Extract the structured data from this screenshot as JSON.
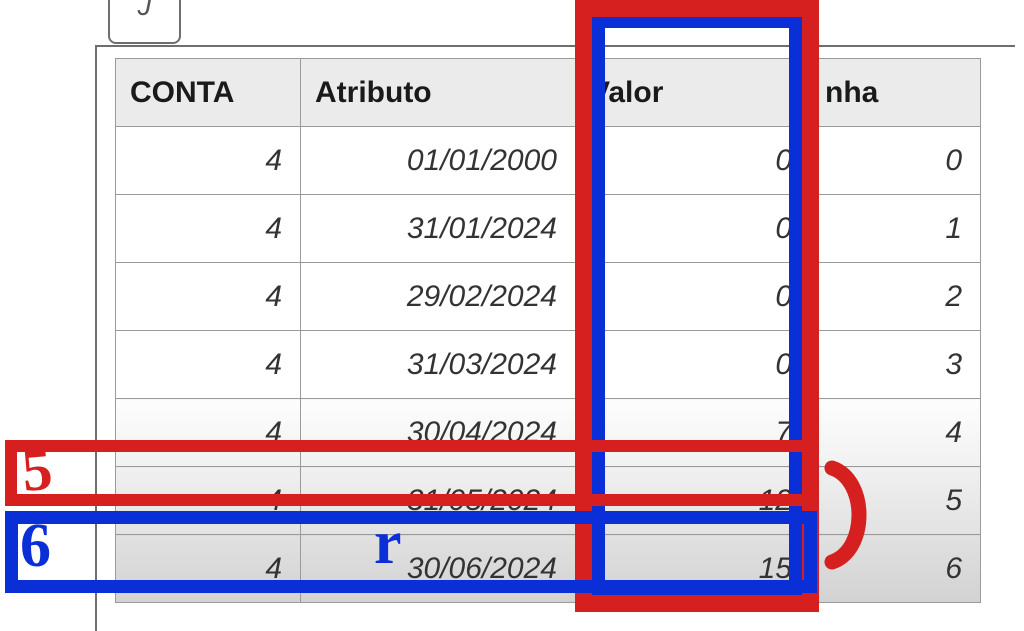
{
  "tab_stub": "J",
  "headers": {
    "conta": "CONTA",
    "atributo": "Atributo",
    "valor": "Valor",
    "linha": "nha"
  },
  "rows": [
    {
      "conta": "4",
      "atributo": "01/01/2000",
      "valor": "0",
      "linha": "0"
    },
    {
      "conta": "4",
      "atributo": "31/01/2024",
      "valor": "0",
      "linha": "1"
    },
    {
      "conta": "4",
      "atributo": "29/02/2024",
      "valor": "0",
      "linha": "2"
    },
    {
      "conta": "4",
      "atributo": "31/03/2024",
      "valor": "0",
      "linha": "3"
    },
    {
      "conta": "4",
      "atributo": "30/04/2024",
      "valor": "7",
      "linha": "4"
    },
    {
      "conta": "4",
      "atributo": "31/05/2024",
      "valor": "12",
      "linha": "5"
    },
    {
      "conta": "4",
      "atributo": "30/06/2024",
      "valor": "15",
      "linha": "6"
    }
  ],
  "annotations": {
    "row5_mark": "5",
    "row6_mark": "6",
    "row6_inner": "r"
  }
}
